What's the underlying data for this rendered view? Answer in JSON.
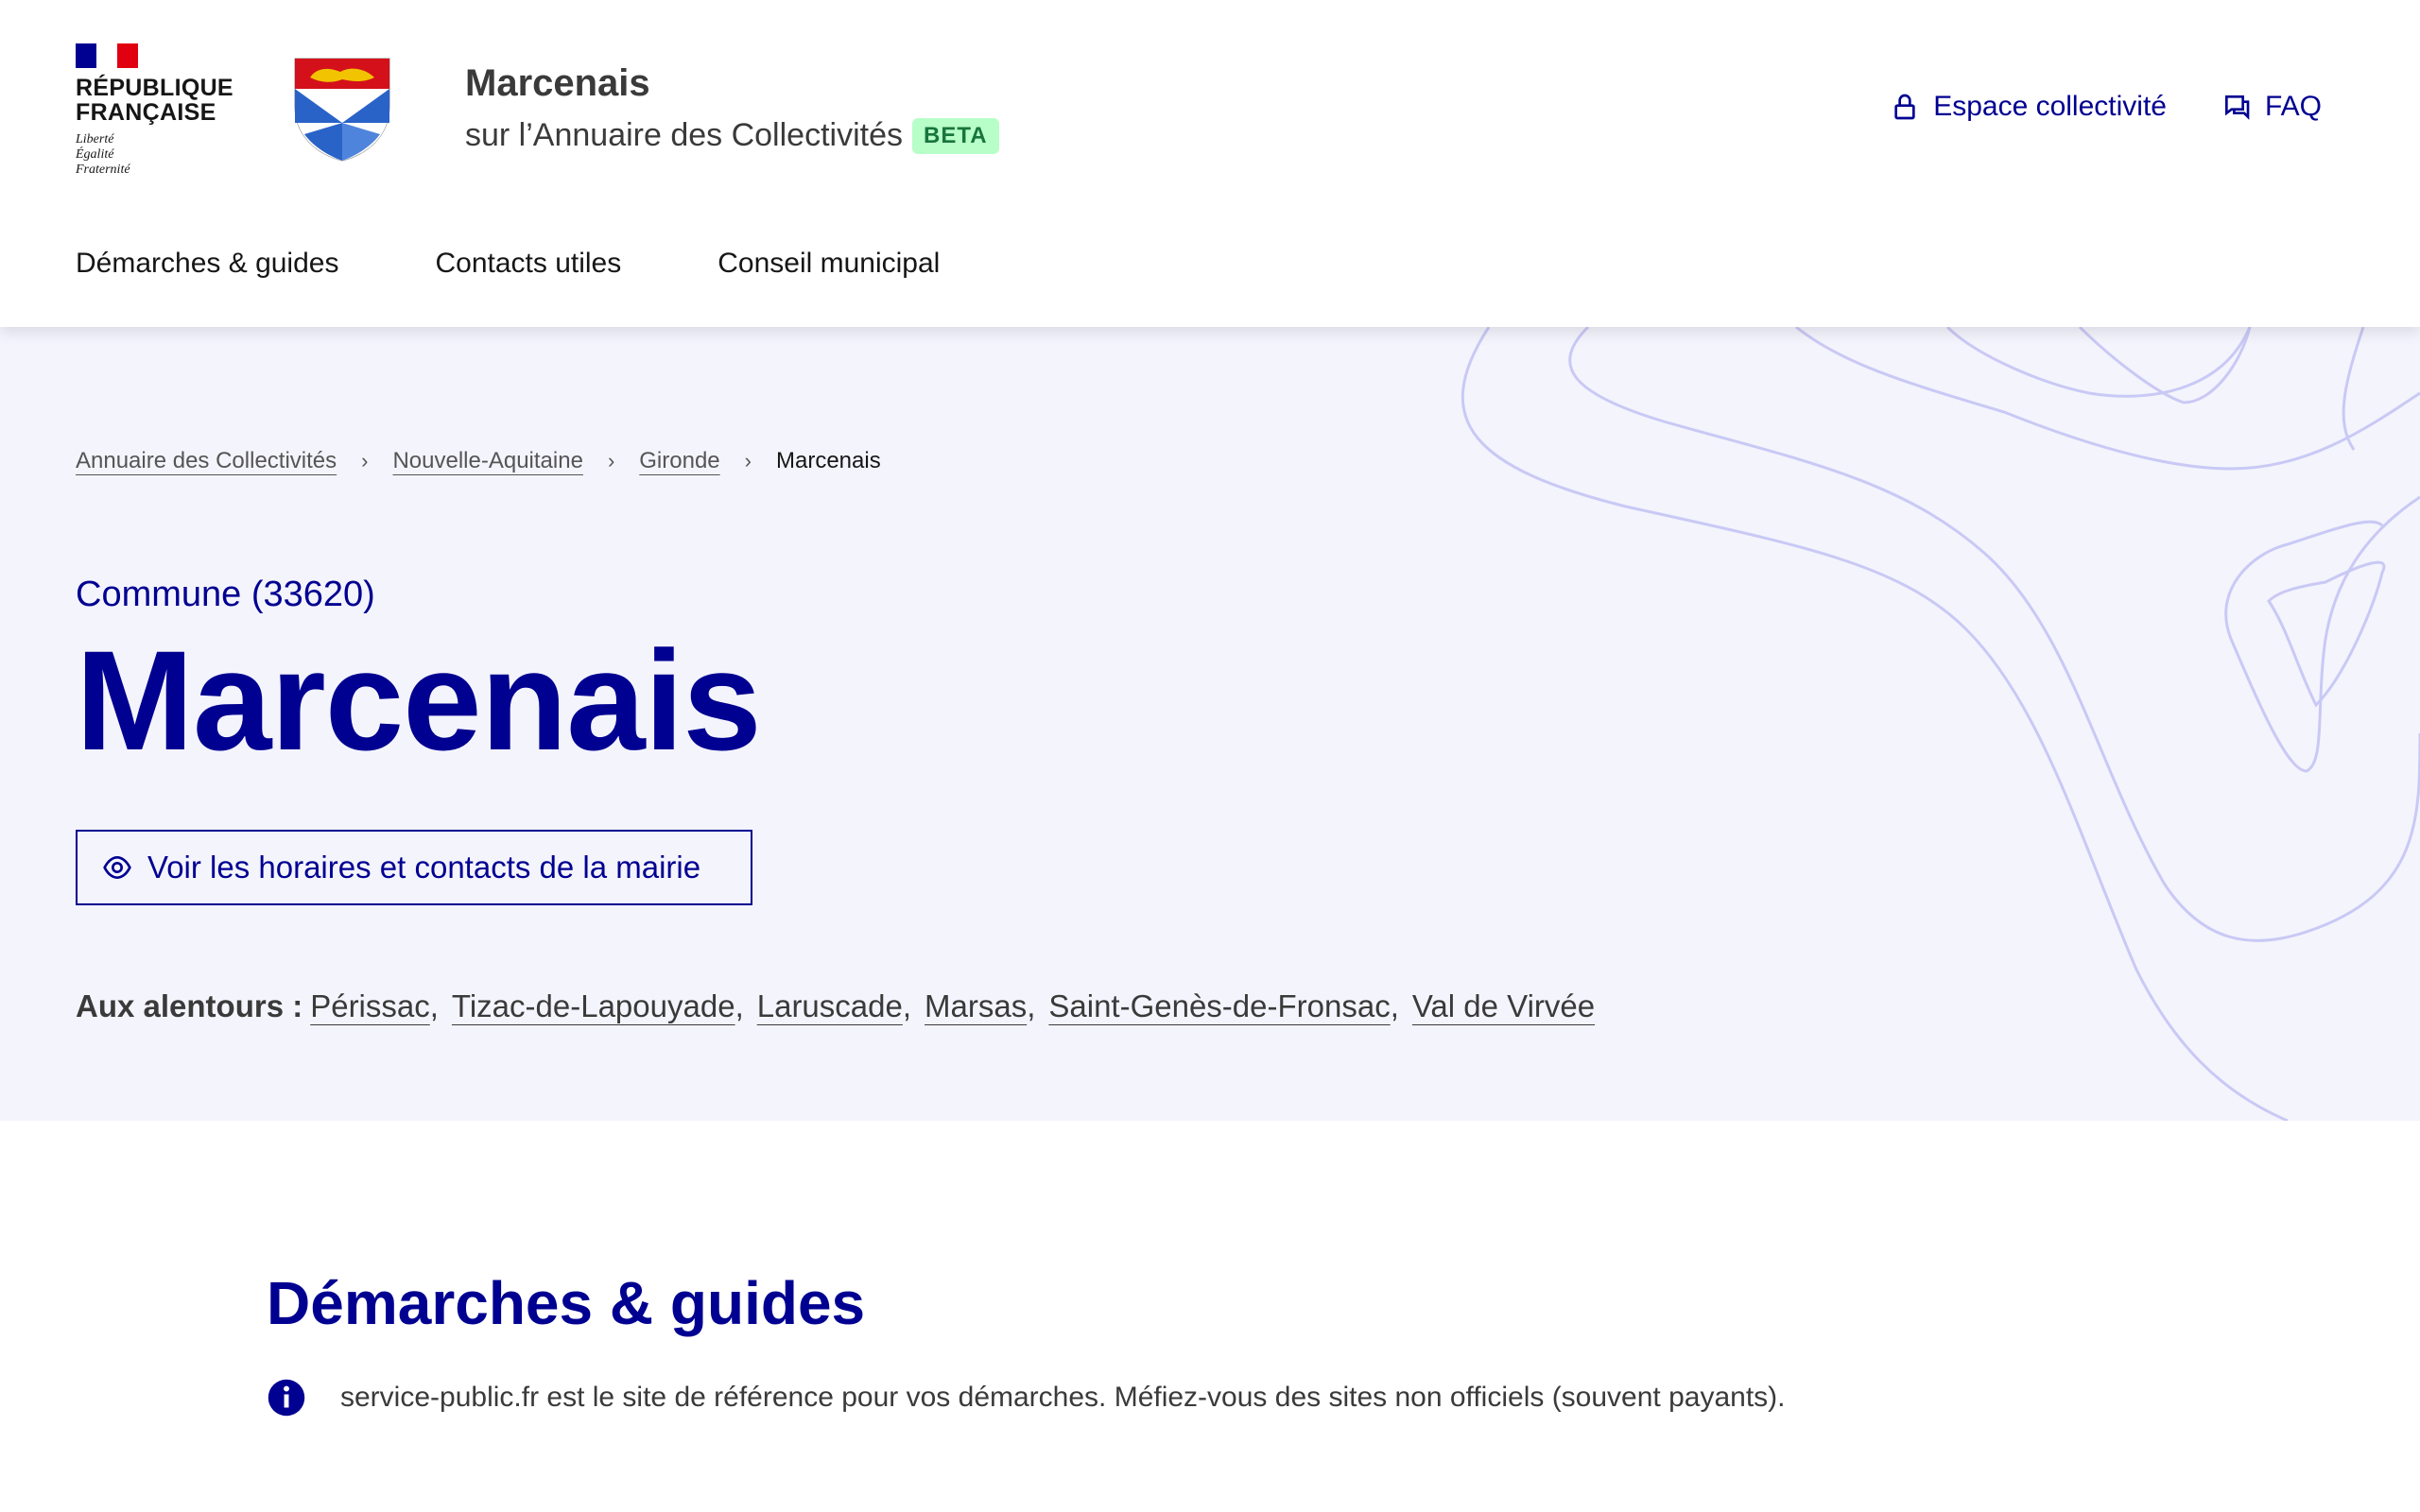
{
  "header": {
    "rf_logo": {
      "name_line1": "RÉPUBLIQUE",
      "name_line2": "FRANÇAISE",
      "motto_1": "Liberté",
      "motto_2": "Égalité",
      "motto_3": "Fraternité"
    },
    "site_title": "Marcenais",
    "site_subtitle": "sur l’Annuaire des Collectivités",
    "badge": "BETA",
    "tools": [
      {
        "label": "Espace collectivité",
        "icon": "lock-icon"
      },
      {
        "label": "FAQ",
        "icon": "chat-icon"
      }
    ],
    "nav": [
      "Démarches & guides",
      "Contacts utiles",
      "Conseil municipal"
    ]
  },
  "breadcrumb": [
    "Annuaire des Collectivités",
    "Nouvelle-Aquitaine",
    "Gironde",
    "Marcenais"
  ],
  "hero": {
    "commune_type": "Commune (33620)",
    "commune_name": "Marcenais",
    "button_label": "Voir les horaires et contacts de la mairie",
    "around_label": "Aux alentours :",
    "around": [
      "Périssac",
      "Tizac-de-Lapouyade",
      "Laruscade",
      "Marsas",
      "Saint-Genès-de-Fronsac",
      "Val de Virvée"
    ]
  },
  "demarches": {
    "title": "Démarches & guides",
    "info": "service-public.fr est le site de référence pour vos démarches. Méfiez-vous des sites non officiels (souvent payants)."
  },
  "colors": {
    "primary": "#000091",
    "hero_bg": "#f4f4fd",
    "beta_bg": "#b8fec9",
    "beta_text": "#18753c",
    "contour": "#c9c9f5"
  }
}
